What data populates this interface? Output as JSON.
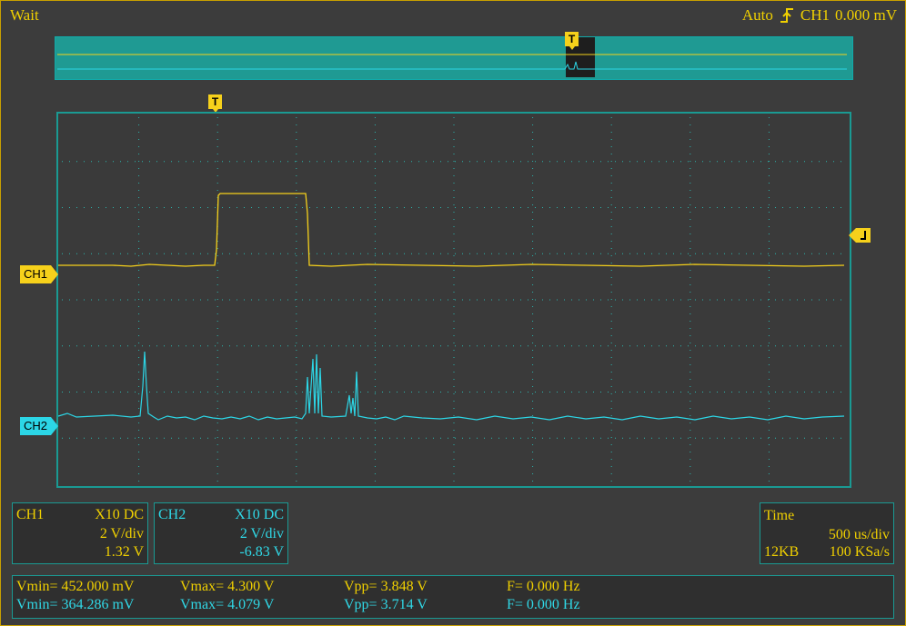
{
  "status": {
    "acq_state": "Wait",
    "trigger_mode": "Auto",
    "trigger_source": "CH1",
    "trigger_level": "0.000 mV"
  },
  "markers": {
    "trigger": "T"
  },
  "channels": {
    "ch1": {
      "label": "CH1",
      "probe": "X10  DC",
      "vdiv": "2 V/div",
      "offset": "1.32 V",
      "color": "#f0d000"
    },
    "ch2": {
      "label": "CH2",
      "probe": "X10  DC",
      "vdiv": "2 V/div",
      "offset": "-6.83 V",
      "color": "#30d8e6"
    }
  },
  "timebase": {
    "title": "Time",
    "tdiv": "500 us/div",
    "memory": "12KB",
    "sample_rate": "100 KSa/s"
  },
  "measurements": {
    "ch1": {
      "vmin": "Vmin= 452.000 mV",
      "vmax": "Vmax= 4.300 V",
      "vpp": "Vpp= 3.848 V",
      "freq": "F= 0.000 Hz"
    },
    "ch2": {
      "vmin": "Vmin= 364.286 mV",
      "vmax": "Vmax= 4.079 V",
      "vpp": "Vpp= 3.714 V",
      "freq": "F= 0.000 Hz"
    }
  },
  "colors": {
    "grid_border": "#1a9a93",
    "grid_dots": "#2bb7b0",
    "ch1": "#f6d11b",
    "ch2": "#2cd6e6",
    "accent": "#f0d000"
  }
}
